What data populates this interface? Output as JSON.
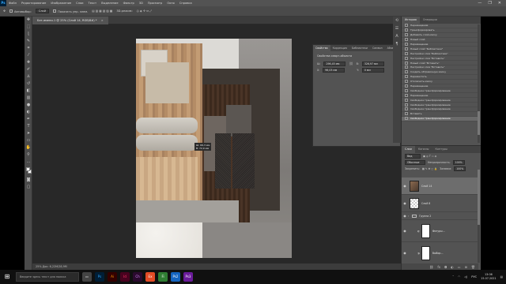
{
  "app": {
    "logo": "Ps",
    "menu": [
      "Файл",
      "Редактирование",
      "Изображение",
      "Слои",
      "Текст",
      "Выделение",
      "Фильтр",
      "3D",
      "Просмотр",
      "Окно",
      "Справка"
    ],
    "window_buttons": [
      "—",
      "❐",
      "✕"
    ]
  },
  "options": {
    "autoselect_label": "Автовыбор:",
    "autoselect_value": "Слой",
    "transform_label": "Показать упр. элем.",
    "mode_3d": "3D-режим:"
  },
  "document": {
    "tab_title": "Без имени-1 @ 25% (Слой 14, RGB/8#) *",
    "close": "×",
    "status": "25%   Док: 6,22M/28,9M"
  },
  "canvas": {
    "transform_readout": [
      "Ш: 66,3 мм",
      "В: 72,9 мм"
    ]
  },
  "properties": {
    "tabs": [
      "Свойства",
      "Коррекция",
      "Библиотеки",
      "Символ",
      "Абзац"
    ],
    "title": "Свойства смарт-объекта",
    "w_value": "296,45 мм",
    "h_value": "326,97 мм",
    "x_value": "96,03 мм",
    "y_value": "0 мм",
    "link_icon": "link-icon"
  },
  "history": {
    "tabs": [
      "История",
      "Операции"
    ],
    "items": [
      "Перемещение",
      "Трансформировать",
      "Добавить слой-маску",
      "Новый слой",
      "Перемещение",
      "Новый слой \"Библиотеки\"",
      "Настройки слоя \"Библиотеки\"",
      "Настройки слоя \"Вставить\"",
      "Новый слой \"Вставить\"",
      "Настройки слоя \"Вставить\"",
      "Создать обтравочную маску",
      "Переместить",
      "Отключить маску",
      "Перемещение",
      "Свободное трансформирование",
      "Перемещение",
      "Свободное трансформирование",
      "Свободное трансформирование",
      "Свободное трансформирование",
      "Вставить",
      "Свободное трансформирование"
    ],
    "selected_index": 20
  },
  "layers": {
    "tabs": [
      "Слои",
      "Каналы",
      "Контуры"
    ],
    "kind_label": "Вид",
    "blend_mode": "Обычные",
    "opacity_label": "Непрозрачность:",
    "opacity_value": "100%",
    "lock_label": "Закрепить:",
    "fill_label": "Заливка:",
    "fill_value": "100%",
    "rows": [
      {
        "name": "Слой 14",
        "selected": true,
        "type": "image"
      },
      {
        "name": "Слой 8",
        "selected": false,
        "type": "transparent"
      },
      {
        "name": "Группа 2",
        "selected": false,
        "type": "group"
      },
      {
        "name": "Фигуры...",
        "selected": false,
        "type": "shape"
      },
      {
        "name": "Выбор...",
        "selected": false,
        "type": "shape"
      }
    ],
    "footer_icons": [
      "link-icon",
      "fx-icon",
      "mask-icon",
      "adjustment-icon",
      "folder-icon",
      "new-layer-icon",
      "trash-icon"
    ]
  },
  "taskbar": {
    "search_placeholder": "Введите здесь текст для поиска",
    "apps": [
      "Ps",
      "Ai",
      "Id",
      "Ch",
      "Ex",
      "Fi",
      "Ps2",
      "Ps3"
    ],
    "lang": "РУС",
    "time": "13:06",
    "date": "15.07.2021"
  },
  "colors": {
    "accent": "#31a8ff",
    "panel": "#535353",
    "canvas_bg": "#282828"
  }
}
